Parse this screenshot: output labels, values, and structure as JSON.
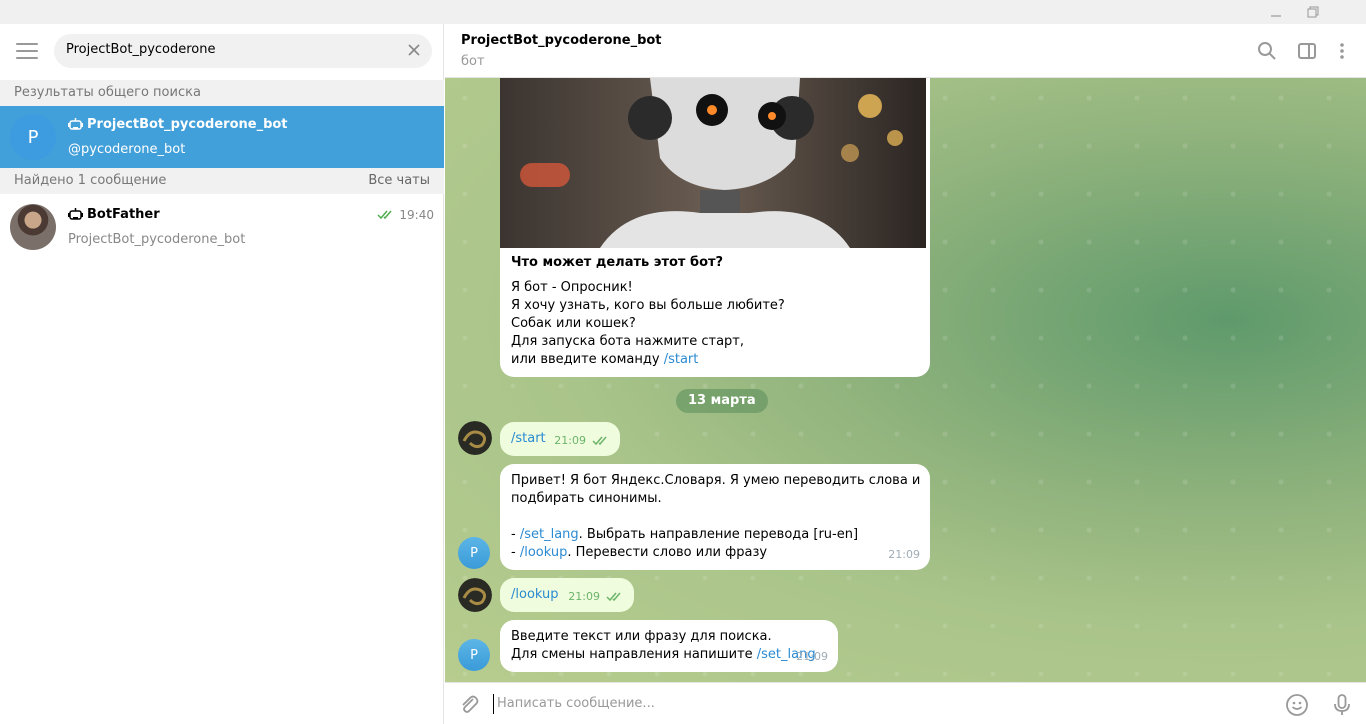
{
  "window": {
    "minimize": "minimize",
    "restore": "restore"
  },
  "sidebar": {
    "search_value": "ProjectBot_pycoderone",
    "global_results_label": "Результаты общего поиска",
    "global_results": [
      {
        "avatar_letter": "P",
        "name": "ProjectBot_pycoderone_bot",
        "username": "@pycoderone_bot",
        "selected": true
      }
    ],
    "messages_found_label": "Найдено 1 сообщение",
    "all_chats_label": "Все чаты",
    "message_results": [
      {
        "name": "BotFather",
        "preview": "ProjectBot_pycoderone_bot",
        "time": "19:40"
      }
    ]
  },
  "chat": {
    "title": "ProjectBot_pycoderone_bot",
    "status": "бот",
    "intro": {
      "heading": "Что может делать этот бот?",
      "lines": [
        "Я бот - Опросник!",
        "Я хочу узнать, кого вы больше любите?",
        "Собак или кошек?",
        "Для запуска бота нажмите старт,"
      ],
      "last_line_prefix": "или введите команду ",
      "last_line_cmd": "/start"
    },
    "date_chip": "13 марта",
    "messages": [
      {
        "dir": "out",
        "cmd": "/start",
        "time": "21:09"
      },
      {
        "dir": "in",
        "line1": "Привет! Я бот Яндекс.Словаря. Я умею переводить слова и",
        "line2": "подбирать синонимы.",
        "cmd1": "/set_lang",
        "text1": ". Выбрать направление перевода [ru-en]",
        "cmd2": "/lookup",
        "text2": ". Перевести слово или фразу",
        "dash": "- ",
        "time": "21:09",
        "avatar_letter": "P"
      },
      {
        "dir": "out",
        "cmd": "/lookup",
        "time": "21:09"
      },
      {
        "dir": "in",
        "line1": "Введите текст или фразу для поиска.",
        "line2_prefix": "Для смены направления напишите ",
        "cmd": "/set_lang",
        "time": "21:09",
        "avatar_letter": "P"
      }
    ]
  },
  "composer": {
    "placeholder": "Написать сообщение..."
  },
  "colors": {
    "accent": "#419fd9",
    "link": "#2a8ad2",
    "out_bubble": "#effdde"
  }
}
